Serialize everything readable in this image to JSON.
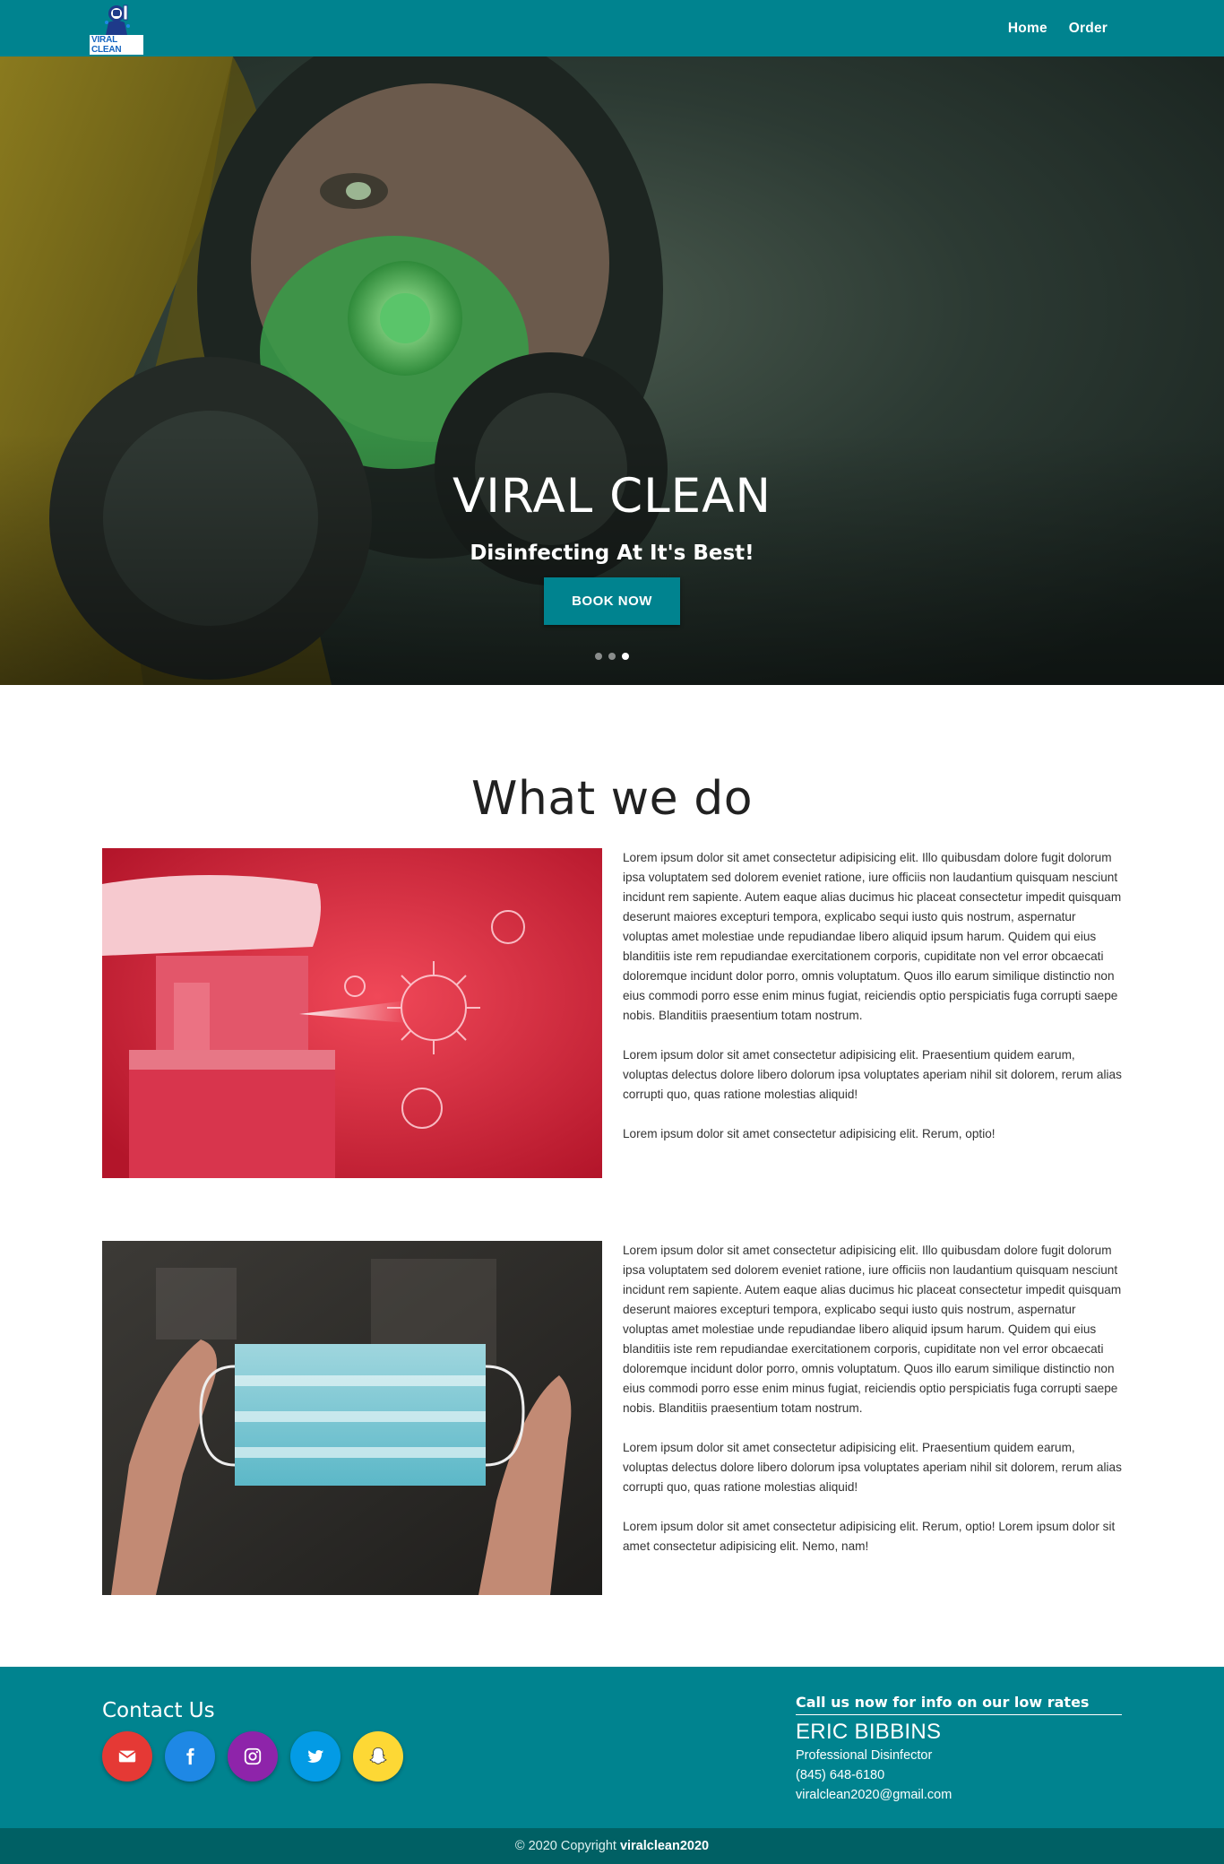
{
  "nav": {
    "logo_text": "VIRAL CLEAN",
    "links": [
      "Home",
      "Order"
    ]
  },
  "hero": {
    "title": "VIRAL CLEAN",
    "subtitle": "Disinfecting At It's Best!",
    "button": "BOOK NOW",
    "slides_total": 3,
    "active_slide": 3
  },
  "about": {
    "title": "What we do",
    "items": [
      {
        "paragraphs": [
          "Lorem ipsum dolor sit amet consectetur adipisicing elit. Illo quibusdam dolore fugit dolorum ipsa voluptatem sed dolorem eveniet ratione, iure officiis non laudantium quisquam nesciunt incidunt rem sapiente. Autem eaque alias ducimus hic placeat consectetur impedit quisquam deserunt maiores excepturi tempora, explicabo sequi iusto quis nostrum, aspernatur voluptas amet molestiae unde repudiandae libero aliquid ipsum harum. Quidem qui eius blanditiis iste rem repudiandae exercitationem corporis, cupiditate non vel error obcaecati doloremque incidunt dolor porro, omnis voluptatum. Quos illo earum similique distinctio non eius commodi porro esse enim minus fugiat, reiciendis optio perspiciatis fuga corrupti saepe nobis. Blanditiis praesentium totam nostrum.",
          "Lorem ipsum dolor sit amet consectetur adipisicing elit. Praesentium quidem earum, voluptas delectus dolore libero dolorum ipsa voluptates aperiam nihil sit dolorem, rerum alias corrupti quo, quas ratione molestias aliquid!",
          "Lorem ipsum dolor sit amet consectetur adipisicing elit. Rerum, optio!"
        ]
      },
      {
        "paragraphs": [
          "Lorem ipsum dolor sit amet consectetur adipisicing elit. Illo quibusdam dolore fugit dolorum ipsa voluptatem sed dolorem eveniet ratione, iure officiis non laudantium quisquam nesciunt incidunt rem sapiente. Autem eaque alias ducimus hic placeat consectetur impedit quisquam deserunt maiores excepturi tempora, explicabo sequi iusto quis nostrum, aspernatur voluptas amet molestiae unde repudiandae libero aliquid ipsum harum. Quidem qui eius blanditiis iste rem repudiandae exercitationem corporis, cupiditate non vel error obcaecati doloremque incidunt dolor porro, omnis voluptatum. Quos illo earum similique distinctio non eius commodi porro esse enim minus fugiat, reiciendis optio perspiciatis fuga corrupti saepe nobis. Blanditiis praesentium totam nostrum.",
          "Lorem ipsum dolor sit amet consectetur adipisicing elit. Praesentium quidem earum, voluptas delectus dolore libero dolorum ipsa voluptates aperiam nihil sit dolorem, rerum alias corrupti quo, quas ratione molestias aliquid!",
          "Lorem ipsum dolor sit amet consectetur adipisicing elit. Rerum, optio! Lorem ipsum dolor sit amet consectetur adipisicing elit. Nemo, nam!"
        ]
      }
    ]
  },
  "footer": {
    "contact_title": "Contact Us",
    "social": [
      {
        "icon": "envelope-icon",
        "color": "#e53935"
      },
      {
        "icon": "facebook-icon",
        "color": "#1e88e5"
      },
      {
        "icon": "instagram-icon",
        "color": "#8e24aa"
      },
      {
        "icon": "twitter-icon",
        "color": "#039be5"
      },
      {
        "icon": "snapchat-icon",
        "color": "#fdd835"
      }
    ],
    "cta": "Call us now for info on our low rates",
    "name": "ERIC BIBBINS",
    "role": "Professional Disinfector",
    "phone": "(845) 648-6180",
    "email": "viralclean2020@gmail.com",
    "copyright_prefix": "© 2020 Copyright",
    "copyright_brand": "viralclean2020"
  },
  "colors": {
    "primary": "#00838f",
    "footer_dark": "#006064"
  }
}
